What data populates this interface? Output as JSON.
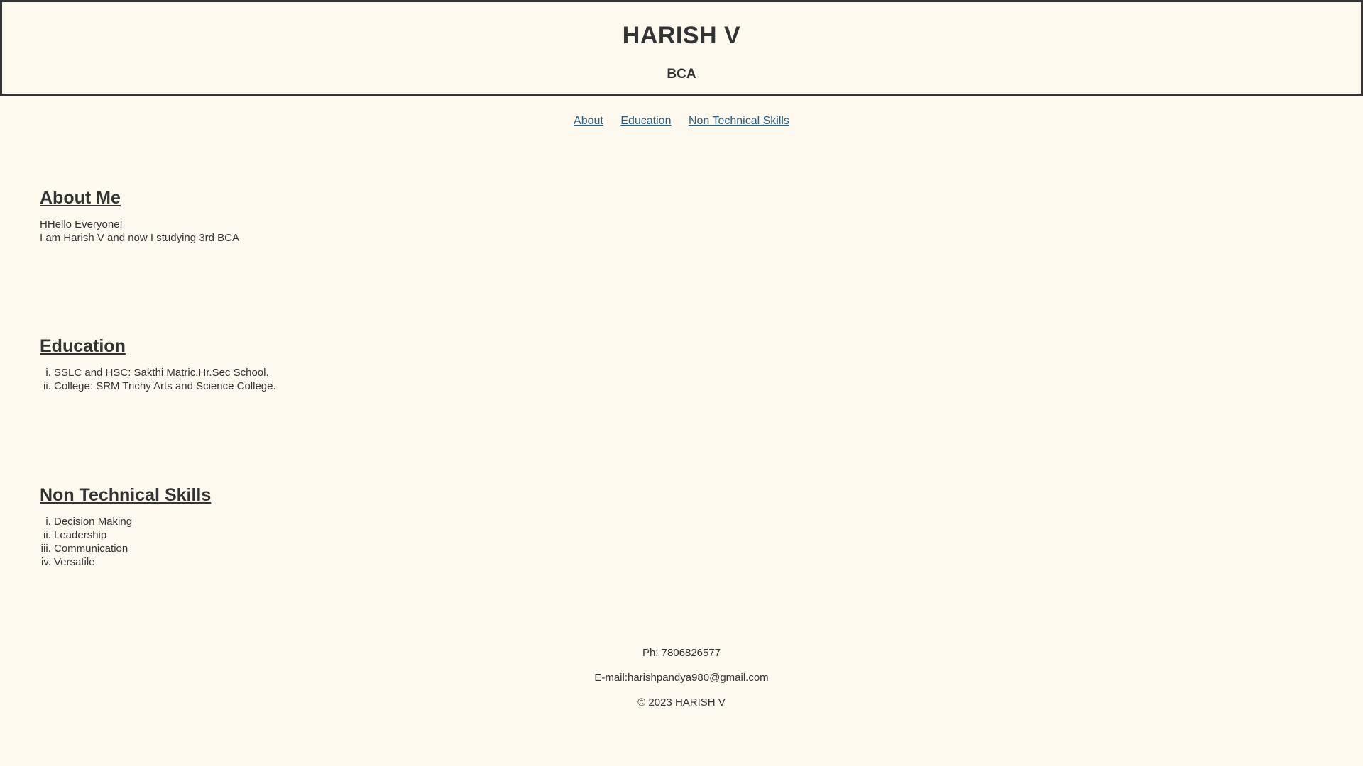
{
  "header": {
    "title": "HARISH V",
    "subtitle": "BCA"
  },
  "nav": {
    "links": [
      "About",
      "Education",
      "Non Technical Skills"
    ]
  },
  "about": {
    "heading": "About Me",
    "line1": "HHello Everyone!",
    "line2": "I am Harish V and now I studying 3rd BCA"
  },
  "education": {
    "heading": "Education",
    "items": [
      "SSLC and HSC: Sakthi Matric.Hr.Sec School.",
      "College: SRM Trichy Arts and Science College."
    ]
  },
  "skills": {
    "heading": "Non Technical Skills",
    "items": [
      "Decision Making",
      "Leadership",
      "Communication",
      "Versatile"
    ]
  },
  "footer": {
    "phone": "Ph: 7806826577",
    "email": "E-mail:harishpandya980@gmail.com",
    "copyright": "© 2023 HARISH V"
  },
  "colors": {
    "background": "#fdf9ee",
    "text": "#333333",
    "link": "#2b5c7d",
    "border": "#333333"
  }
}
